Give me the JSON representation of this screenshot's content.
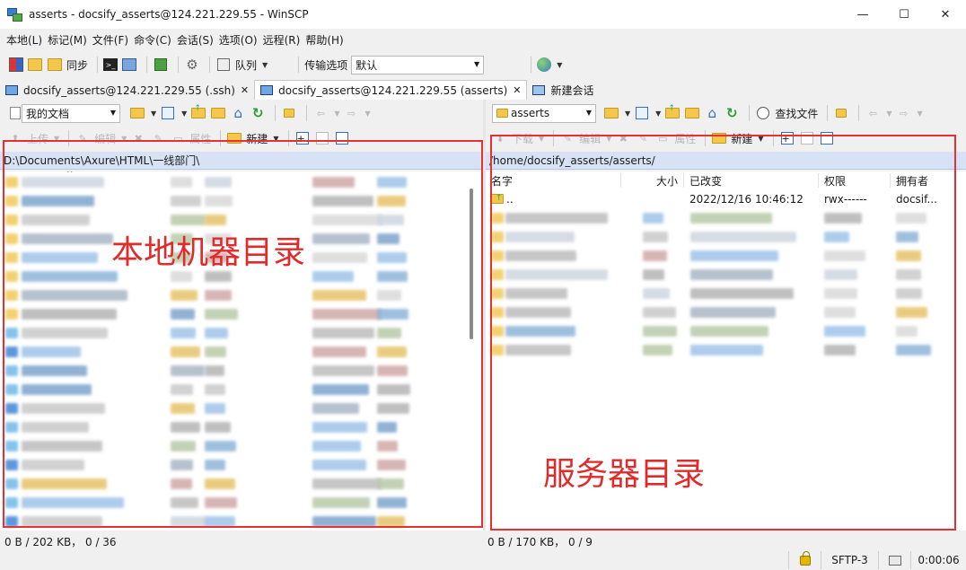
{
  "window": {
    "title": "asserts - docsify_asserts@124.221.229.55 - WinSCP",
    "controls": {
      "minimize": "—",
      "maximize": "☐",
      "close": "✕"
    }
  },
  "menu": [
    "本地(L)",
    "标记(M)",
    "文件(F)",
    "命令(C)",
    "会话(S)",
    "选项(O)",
    "远程(R)",
    "帮助(H)"
  ],
  "toolbar": {
    "sync_label": "同步",
    "queue_label": "队列",
    "transfer_label": "传输选项",
    "transfer_value": "默认"
  },
  "tabs": [
    {
      "label": "docsify_asserts@124.221.229.55 (.ssh)",
      "close": "✕"
    },
    {
      "label": "docsify_asserts@124.221.229.55 (asserts)",
      "close": "✕"
    },
    {
      "label": "新建会话"
    }
  ],
  "local": {
    "drive": "我的文档",
    "upload": "上传",
    "edit": "编辑",
    "properties": "属性",
    "new": "新建",
    "path": "D:\\Documents\\Axure\\HTML\\一线部门\\",
    "status": "0 B / 202 KB， 0 / 36",
    "annotation": "本地机器目录"
  },
  "remote": {
    "drive": "asserts",
    "find": "查找文件",
    "download": "下载",
    "edit": "编辑",
    "properties": "属性",
    "new": "新建",
    "path": "/home/docsify_asserts/asserts/",
    "columns": {
      "name": "名字",
      "size": "大小",
      "changed": "已改变",
      "rights": "权限",
      "owner": "拥有者"
    },
    "parent_row": {
      "name": "..",
      "changed": "2022/12/16 10:46:12",
      "rights": "rwx------",
      "owner": "docsif..."
    },
    "status": "0 B / 170 KB， 0 / 9",
    "annotation": "服务器目录"
  },
  "statusbar": {
    "protocol": "SFTP-3",
    "time": "0:00:06"
  },
  "icons": {
    "app": "winscp-icon",
    "lock": "lock-icon",
    "folder_color": "#f4c64a",
    "accent": "#e02b2b"
  }
}
